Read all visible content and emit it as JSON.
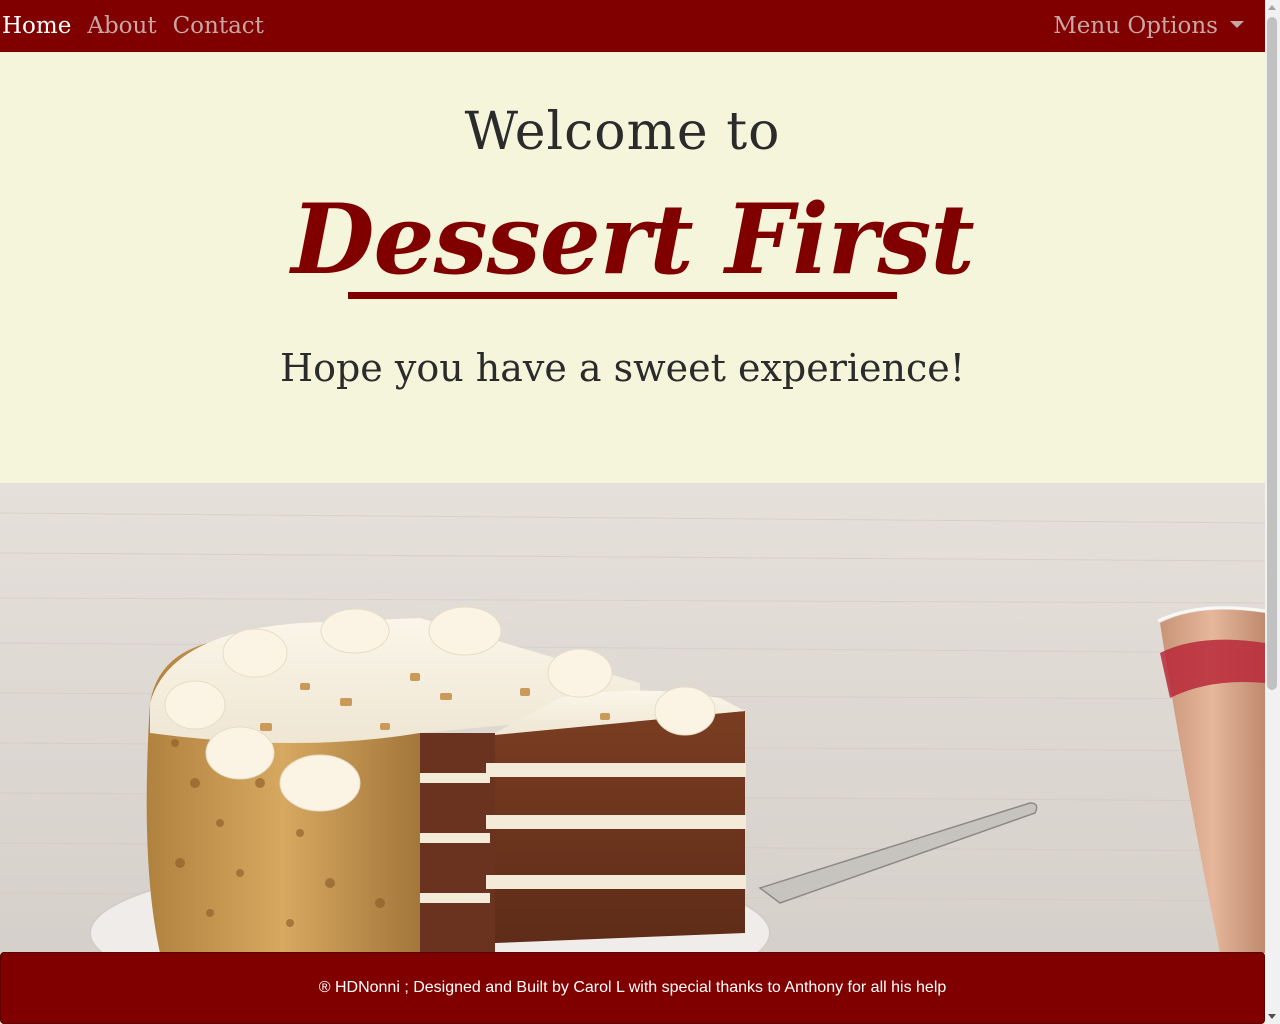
{
  "nav": {
    "links": [
      {
        "label": "Home",
        "active": true
      },
      {
        "label": "About",
        "active": false
      },
      {
        "label": "Contact",
        "active": false
      }
    ],
    "dropdown_label": "Menu Options",
    "dropdown_icon": "caret-down-icon"
  },
  "hero": {
    "welcome": "Welcome to",
    "brand": "Dessert First",
    "tagline": "Hope you have a sweet experience!"
  },
  "footer": {
    "text": "® HDNonni ; Designed and Built by Carol L with special thanks to Anthony for all his help"
  },
  "colors": {
    "brand": "#800000",
    "background": "#f5f5dc",
    "nav_inactive": "#c7a6a6",
    "nav_active": "#ffffff"
  }
}
